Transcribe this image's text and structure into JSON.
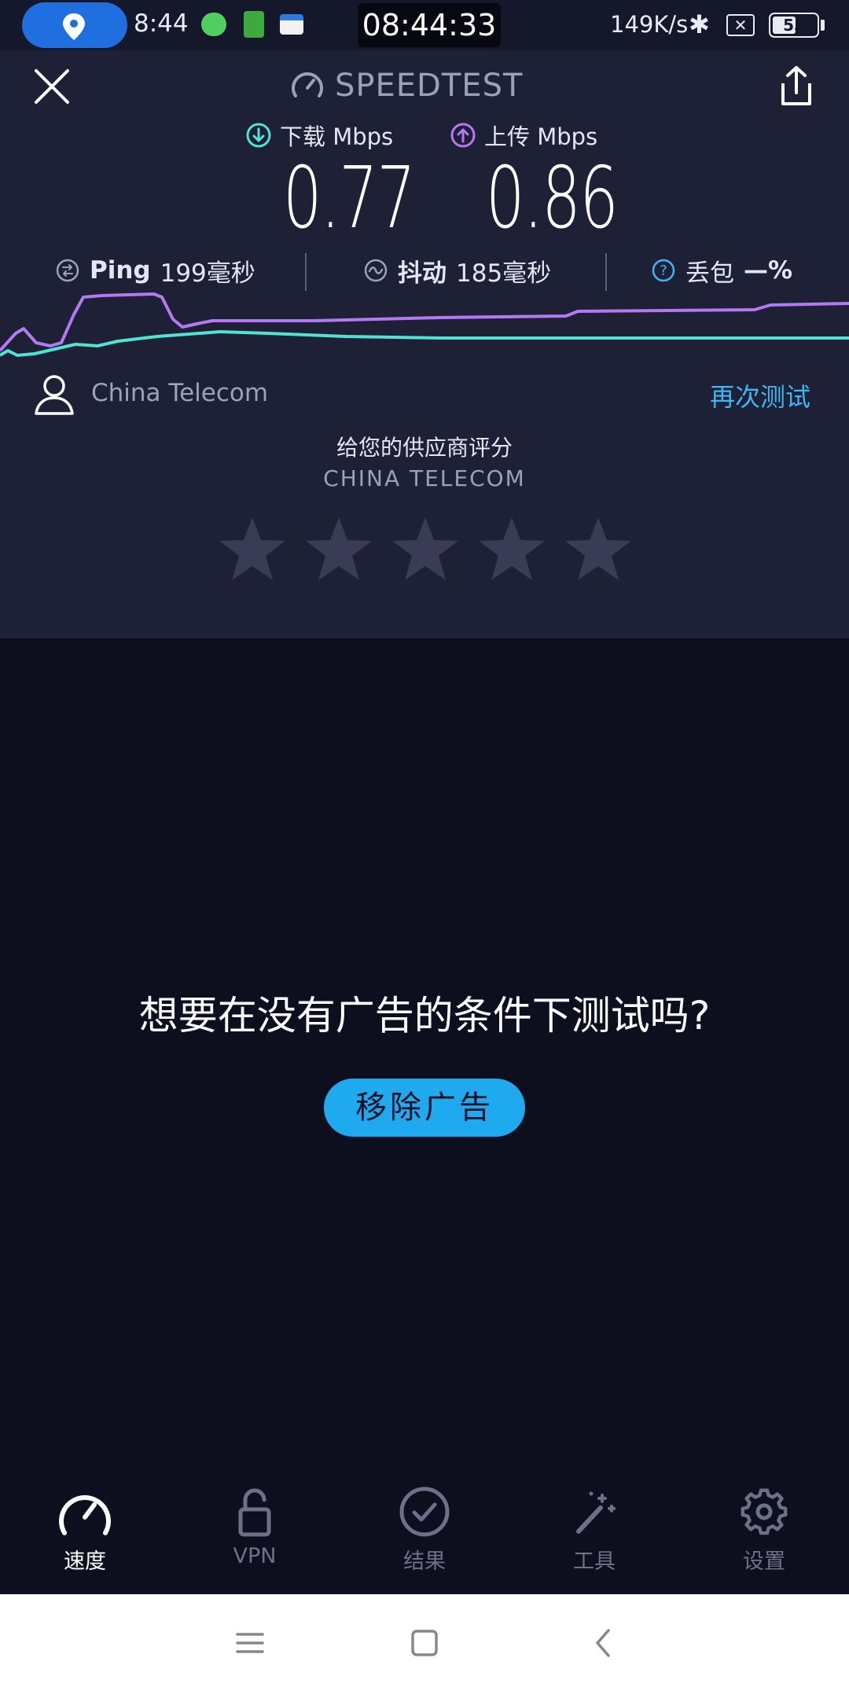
{
  "status_bar": {
    "time": "8:44",
    "clock": "08:44:33",
    "net_speed": "149K/s",
    "battery": "53"
  },
  "header": {
    "title": "SPEEDTEST"
  },
  "download": {
    "label": "下载 Mbps",
    "value": "0.77"
  },
  "upload": {
    "label": "上传 Mbps",
    "value": "0.86"
  },
  "ping": {
    "label": "Ping",
    "value": "199毫秒"
  },
  "jitter": {
    "label": "抖动",
    "value": "185毫秒"
  },
  "loss": {
    "label": "丢包",
    "value": "—%"
  },
  "provider": {
    "name": "China Telecom",
    "retest": "再次测试"
  },
  "rating": {
    "title": "给您的供应商评分",
    "subtitle": "CHINA TELECOM",
    "stars": 0,
    "max_stars": 5
  },
  "ad": {
    "question": "想要在没有广告的条件下测试吗?",
    "button": "移除广告"
  },
  "nav": {
    "items": [
      {
        "label": "速度",
        "icon": "speedometer-icon",
        "active": true
      },
      {
        "label": "VPN",
        "icon": "lock-icon",
        "active": false
      },
      {
        "label": "结果",
        "icon": "check-circle-icon",
        "active": false
      },
      {
        "label": "工具",
        "icon": "magic-wand-icon",
        "active": false
      },
      {
        "label": "设置",
        "icon": "gear-icon",
        "active": false
      }
    ]
  },
  "colors": {
    "accent": "#3db6f2",
    "download": "#4fe3d2",
    "upload": "#b27af0",
    "panel": "#1e2036",
    "background": "#0d0f1f"
  }
}
